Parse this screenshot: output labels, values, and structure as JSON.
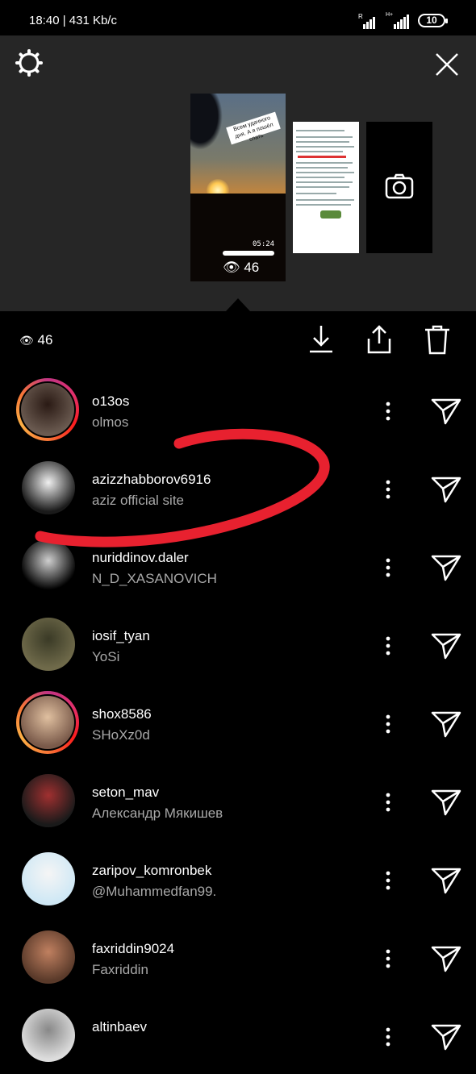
{
  "status_bar": {
    "time": "18:40 | 431 Kb/c",
    "battery": "10"
  },
  "story_tray": {
    "sticker_text": "Всем удачного дня. А я пошёл спать",
    "story_time": "05:24",
    "story_views": "46"
  },
  "actions": {
    "views": "46"
  },
  "viewers": [
    {
      "username": "o13os",
      "full_name": "olmos",
      "has_story": true,
      "avatar_colors": [
        "#6a5a50",
        "#2a1a14"
      ]
    },
    {
      "username": "azizzhabborov6916",
      "full_name": "aziz official site",
      "has_story": false,
      "avatar_colors": [
        "#1a1a1a",
        "#f0f0f0"
      ]
    },
    {
      "username": "nuriddinov.daler",
      "full_name": "N_D_XASANOVICH",
      "has_story": false,
      "avatar_colors": [
        "#000000",
        "#cfcfcf"
      ]
    },
    {
      "username": "iosif_tyan",
      "full_name": "YoSi",
      "has_story": false,
      "avatar_colors": [
        "#6f6a4a",
        "#3a3a26"
      ]
    },
    {
      "username": "shox8586",
      "full_name": "SHoXz0d",
      "has_story": true,
      "avatar_colors": [
        "#7a5a4a",
        "#e0c0a0"
      ]
    },
    {
      "username": "seton_mav",
      "full_name": "Александр Мякишев",
      "has_story": false,
      "avatar_colors": [
        "#1a1a1a",
        "#a03030"
      ]
    },
    {
      "username": "zaripov_komronbek",
      "full_name": "@Muhammedfan99.",
      "has_story": false,
      "avatar_colors": [
        "#cfe8f5",
        "#f5f5f5"
      ]
    },
    {
      "username": "faxriddin9024",
      "full_name": "Faxriddin",
      "has_story": false,
      "avatar_colors": [
        "#5a3a2a",
        "#c08060"
      ]
    },
    {
      "username": "altinbaev",
      "full_name": "",
      "has_story": false,
      "avatar_colors": [
        "#dddddd",
        "#888888"
      ]
    }
  ],
  "annotation_color": "#e8212f"
}
